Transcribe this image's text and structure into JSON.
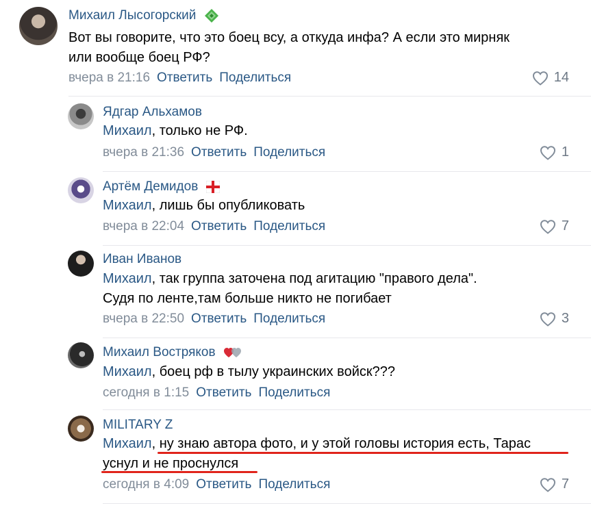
{
  "comments": [
    {
      "author": "Михаил Лысогорский",
      "badge_icon": "green-diamond-icon",
      "mention": "",
      "text_line1": "Вот вы говорите, что это боец всу, а откуда инфа? А если это мирняк",
      "text_line2": "или вообще боец РФ?",
      "time": "вчера в 21:16",
      "reply_label": "Ответить",
      "share_label": "Поделиться",
      "likes": "14"
    },
    {
      "author": "Ядгар Альхамов",
      "mention": "Михаил",
      "text_line1": ", только не РФ.",
      "time": "вчера в 21:36",
      "reply_label": "Ответить",
      "share_label": "Поделиться",
      "likes": "1"
    },
    {
      "author": "Артём Демидов",
      "badge_icon": "red-cross-flag-icon",
      "mention": "Михаил",
      "text_line1": ", лишь бы опубликовать",
      "time": "вчера в 22:04",
      "reply_label": "Ответить",
      "share_label": "Поделиться",
      "likes": "7"
    },
    {
      "author": "Иван Иванов",
      "mention": "Михаил",
      "text_line1": ", так группа заточена под агитацию \"правого дела\".",
      "text_line2": "Судя по ленте,там больше никто не погибает",
      "time": "вчера в 22:50",
      "reply_label": "Ответить",
      "share_label": "Поделиться",
      "likes": "3"
    },
    {
      "author": "Михаил Востряков",
      "badge_icon": "hearts-icon",
      "mention": "Михаил",
      "text_line1": ", боец рф в тылу украинских войск???",
      "time": "сегодня в 1:15",
      "reply_label": "Ответить",
      "share_label": "Поделиться",
      "likes": ""
    },
    {
      "author": "MILITARY Z",
      "mention": "Михаил",
      "text_line1": ", ну знаю автора фото, и у этой головы история есть, Тарас",
      "text_line2": "уснул и не проснулся",
      "time": "сегодня в 4:09",
      "reply_label": "Ответить",
      "share_label": "Поделиться",
      "likes": "7"
    }
  ],
  "colors": {
    "link": "#2a5885",
    "meta": "#818c99",
    "underline": "#e0241b",
    "separator": "#e7e8ec"
  }
}
